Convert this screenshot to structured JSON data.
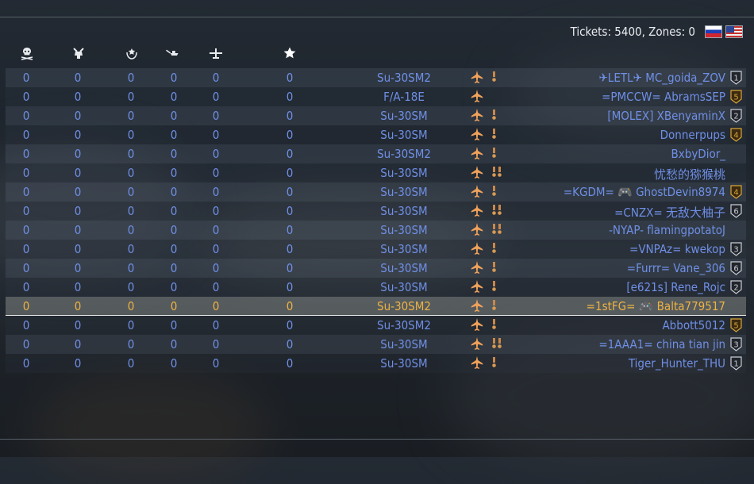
{
  "header": {
    "tickets_text": "Tickets: 5400, Zones: 0",
    "columns": [
      {
        "icon": "skull-icon"
      },
      {
        "icon": "ground-kills-icon"
      },
      {
        "icon": "assists-icon"
      },
      {
        "icon": "naval-icon"
      },
      {
        "icon": "aircraft-icon"
      },
      {
        "icon": "score-star-icon"
      }
    ],
    "flags": [
      "russia-flag-icon",
      "usa-flag-icon"
    ]
  },
  "colors": {
    "ally": "#6f8fe6",
    "self": "#ecb243",
    "jet": "#f0a25a",
    "rank_silver": "#c8ccd4",
    "rank_gold": "#d7a43a"
  },
  "rows": [
    {
      "stats": [
        "0",
        "0",
        "0",
        "0",
        "0",
        "0"
      ],
      "vehicle": "Su-30SM2",
      "name": "✈LETL✈ MC_goida_ZOV",
      "rank": "1",
      "rank_tier": "silver",
      "medals": 1
    },
    {
      "stats": [
        "0",
        "0",
        "0",
        "0",
        "0",
        "0"
      ],
      "vehicle": "F/A-18E",
      "name": "=PMCCW= AbramsSEP",
      "rank": "5",
      "rank_tier": "gold",
      "medals": 0
    },
    {
      "stats": [
        "0",
        "0",
        "0",
        "0",
        "0",
        "0"
      ],
      "vehicle": "Su-30SM",
      "name": "[MOLEX] XBenyaminX",
      "rank": "2",
      "rank_tier": "silver",
      "medals": 1
    },
    {
      "stats": [
        "0",
        "0",
        "0",
        "0",
        "0",
        "0"
      ],
      "vehicle": "Su-30SM",
      "name": "Donnerpups",
      "rank": "4",
      "rank_tier": "gold",
      "medals": 1
    },
    {
      "stats": [
        "0",
        "0",
        "0",
        "0",
        "0",
        "0"
      ],
      "vehicle": "Su-30SM2",
      "name": "BxbyDior_",
      "rank": "",
      "rank_tier": "none",
      "medals": 1
    },
    {
      "stats": [
        "0",
        "0",
        "0",
        "0",
        "0",
        "0"
      ],
      "vehicle": "Su-30SM",
      "name": "忧愁的猕猴桃",
      "rank": "",
      "rank_tier": "none",
      "medals": 2
    },
    {
      "stats": [
        "0",
        "0",
        "0",
        "0",
        "0",
        "0"
      ],
      "vehicle": "Su-30SM",
      "name": "=KGDM= 🎮 GhostDevin8974",
      "rank": "4",
      "rank_tier": "gold",
      "medals": 1
    },
    {
      "stats": [
        "0",
        "0",
        "0",
        "0",
        "0",
        "0"
      ],
      "vehicle": "Su-30SM",
      "name": "=CNZX= 无敌大柚子",
      "rank": "6",
      "rank_tier": "silver",
      "medals": 2
    },
    {
      "stats": [
        "0",
        "0",
        "0",
        "0",
        "0",
        "0"
      ],
      "vehicle": "Su-30SM",
      "name": "-NYAP- flamingpotatoJ",
      "rank": "",
      "rank_tier": "none",
      "medals": 2
    },
    {
      "stats": [
        "0",
        "0",
        "0",
        "0",
        "0",
        "0"
      ],
      "vehicle": "Su-30SM",
      "name": "=VNPAz= kwekop",
      "rank": "3",
      "rank_tier": "silver",
      "medals": 1
    },
    {
      "stats": [
        "0",
        "0",
        "0",
        "0",
        "0",
        "0"
      ],
      "vehicle": "Su-30SM",
      "name": "=Furrr= Vane_306",
      "rank": "6",
      "rank_tier": "silver",
      "medals": 1
    },
    {
      "stats": [
        "0",
        "0",
        "0",
        "0",
        "0",
        "0"
      ],
      "vehicle": "Su-30SM",
      "name": "[e621s] Rene_Rojc",
      "rank": "2",
      "rank_tier": "silver",
      "medals": 1
    },
    {
      "stats": [
        "0",
        "0",
        "0",
        "0",
        "0",
        "0"
      ],
      "vehicle": "Su-30SM2",
      "name": "=1stFG= 🎮 Balta779517",
      "rank": "",
      "rank_tier": "none",
      "medals": 1,
      "self": true
    },
    {
      "stats": [
        "0",
        "0",
        "0",
        "0",
        "0",
        "0"
      ],
      "vehicle": "Su-30SM2",
      "name": "Abbott5012",
      "rank": "5",
      "rank_tier": "gold",
      "medals": 1
    },
    {
      "stats": [
        "0",
        "0",
        "0",
        "0",
        "0",
        "0"
      ],
      "vehicle": "Su-30SM",
      "name": "=1AAA1= china tian jin",
      "rank": "3",
      "rank_tier": "silver",
      "medals": 2
    },
    {
      "stats": [
        "0",
        "0",
        "0",
        "0",
        "0",
        "0"
      ],
      "vehicle": "Su-30SM",
      "name": "Tiger_Hunter_THU",
      "rank": "1",
      "rank_tier": "silver",
      "medals": 1
    }
  ]
}
